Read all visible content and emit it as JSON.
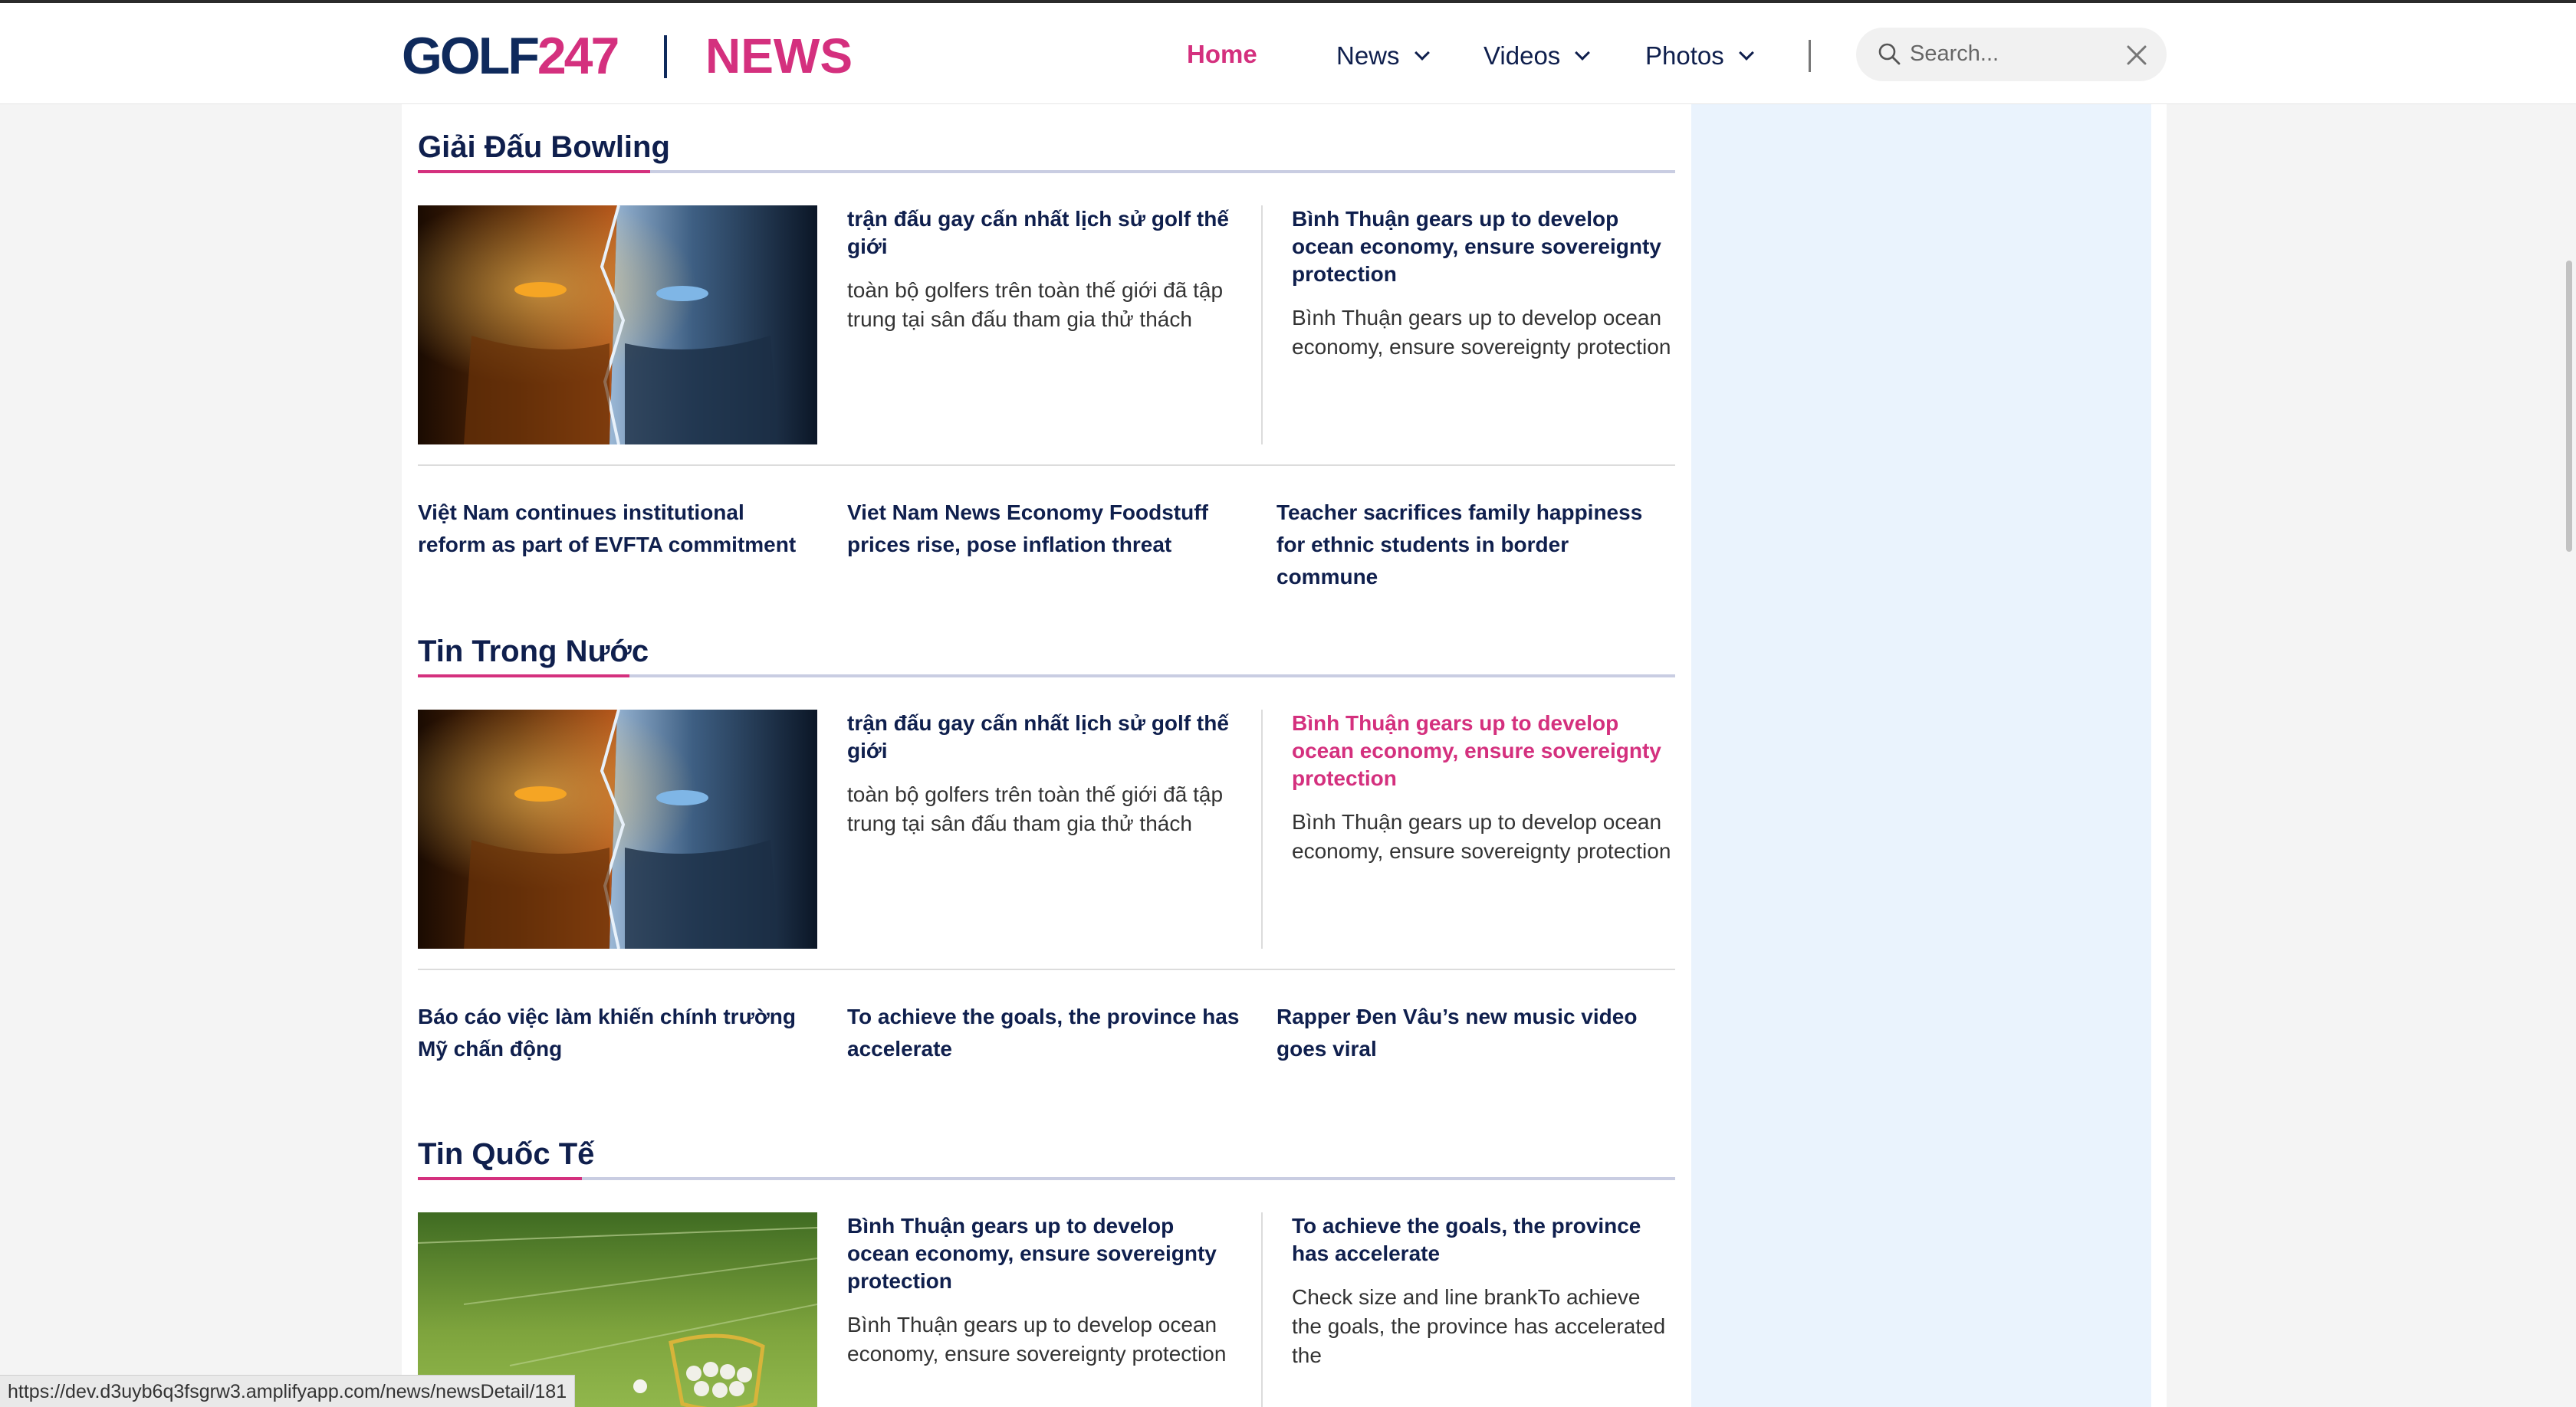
{
  "header": {
    "logo_left": "GOLF",
    "logo_right": "247",
    "section_name": "NEWS",
    "nav": [
      {
        "label": "Home"
      },
      {
        "label": "News"
      },
      {
        "label": "Videos"
      },
      {
        "label": "Photos"
      }
    ],
    "search_placeholder": "Search..."
  },
  "sections": [
    {
      "title": "Giải Đấu Bowling",
      "image": "fire-ice-warrior-poster",
      "feature": {
        "title": "trận đấu gay cấn nhất lịch sử golf thế giới",
        "desc": "toàn bộ golfers trên toàn thế giới đã tập trung tại sân đấu tham gia thử thách"
      },
      "side": {
        "title": "Bình Thuận gears up to develop ocean economy, ensure sovereignty protection",
        "desc": "Bình Thuận gears up to develop ocean economy, ensure sovereignty protection"
      },
      "related": [
        "Việt Nam continues institutional reform as part of EVFTA commitment",
        "Viet Nam News Economy Foodstuff prices rise, pose inflation threat",
        "Teacher sacrifices family happiness for ethnic students in border commune"
      ]
    },
    {
      "title": "Tin Trong Nước",
      "image": "fire-ice-warrior-poster",
      "feature": {
        "title": "trận đấu gay cấn nhất lịch sử golf thế giới",
        "desc": "toàn bộ golfers trên toàn thế giới đã tập trung tại sân đấu tham gia thử thách"
      },
      "side": {
        "title": "Bình Thuận gears up to develop ocean economy, ensure sovereignty protection",
        "desc": "Bình Thuận gears up to develop ocean economy, ensure sovereignty protection"
      },
      "related": [
        "Báo cáo việc làm khiến chính trường Mỹ chấn động",
        "To achieve the goals, the province has accelerate",
        "Rapper Đen Vâu’s new music video goes viral"
      ]
    },
    {
      "title": "Tin Quốc Tế",
      "image": "golf-range-ball-basket",
      "feature": {
        "title": "Bình Thuận gears up to develop ocean economy, ensure sovereignty protection",
        "desc": "Bình Thuận gears up to develop ocean economy, ensure sovereignty protection"
      },
      "side": {
        "title": "To achieve the goals, the province has accelerate",
        "desc": "Check size and line brankTo achieve the goals, the province has accelerated the"
      }
    }
  ],
  "status_url": "https://dev.d3uyb6q3fsgrw3.amplifyapp.com/news/newsDetail/181",
  "colors": {
    "brand_pink": "#d4307e",
    "navy": "#0f1f4d",
    "sidebar_bg": "#eaf3fd"
  }
}
